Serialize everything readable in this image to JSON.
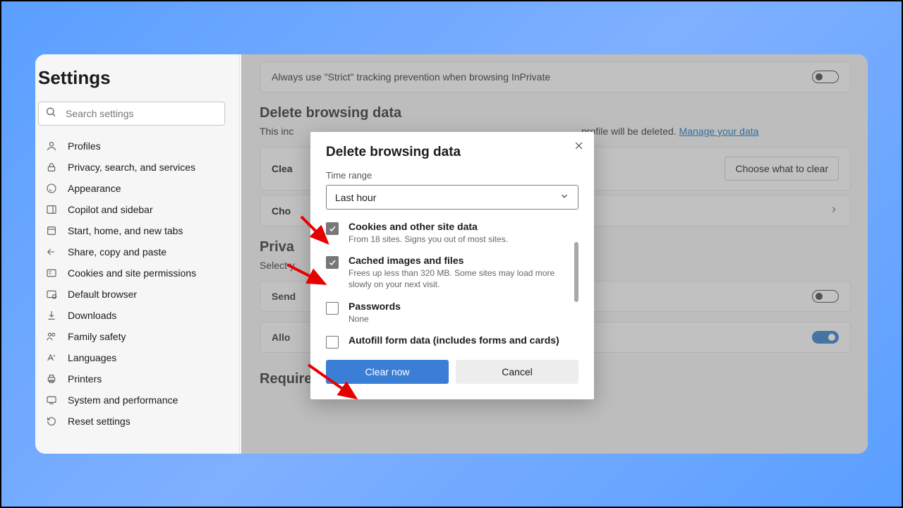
{
  "sidebar": {
    "title": "Settings",
    "search_placeholder": "Search settings",
    "items": [
      {
        "icon": "profile",
        "label": "Profiles"
      },
      {
        "icon": "lock",
        "label": "Privacy, search, and services"
      },
      {
        "icon": "appearance",
        "label": "Appearance"
      },
      {
        "icon": "sidebar",
        "label": "Copilot and sidebar"
      },
      {
        "icon": "home",
        "label": "Start, home, and new tabs"
      },
      {
        "icon": "share",
        "label": "Share, copy and paste"
      },
      {
        "icon": "cookies",
        "label": "Cookies and site permissions"
      },
      {
        "icon": "browser",
        "label": "Default browser"
      },
      {
        "icon": "download",
        "label": "Downloads"
      },
      {
        "icon": "family",
        "label": "Family safety"
      },
      {
        "icon": "language",
        "label": "Languages"
      },
      {
        "icon": "printer",
        "label": "Printers"
      },
      {
        "icon": "system",
        "label": "System and performance"
      },
      {
        "icon": "reset",
        "label": "Reset settings"
      }
    ]
  },
  "main": {
    "strict_row": "Always use \"Strict\" tracking prevention when browsing InPrivate",
    "delete_title": "Delete browsing data",
    "delete_desc_prefix": "This inc",
    "delete_desc_suffix": "profile will be deleted. ",
    "manage_link": "Manage your data",
    "clear_row": "Clea",
    "choose_btn": "Choose what to clear",
    "choose_row": "Cho",
    "privacy_title": "Priva",
    "select_desc": "Select y",
    "send_row": "Send",
    "allow_row": "Allo",
    "required_title": "Required diagnostic data"
  },
  "modal": {
    "title": "Delete browsing data",
    "time_label": "Time range",
    "time_value": "Last hour",
    "items": [
      {
        "checked": true,
        "label": "Cookies and other site data",
        "sub": "From 18 sites. Signs you out of most sites."
      },
      {
        "checked": true,
        "label": "Cached images and files",
        "sub": "Frees up less than 320 MB. Some sites may load more slowly on your next visit."
      },
      {
        "checked": false,
        "label": "Passwords",
        "sub": "None"
      },
      {
        "checked": false,
        "label": "Autofill form data (includes forms and cards)",
        "sub": ""
      }
    ],
    "clear_btn": "Clear now",
    "cancel_btn": "Cancel"
  }
}
